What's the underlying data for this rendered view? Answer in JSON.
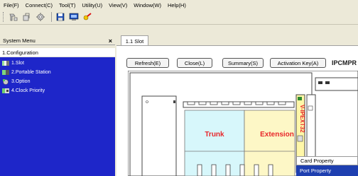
{
  "menubar": {
    "items": [
      "File(F)",
      "Connect(C)",
      "Tool(T)",
      "Utility(U)",
      "View(V)",
      "Window(W)",
      "Help(H)"
    ]
  },
  "toolbar": {
    "icons": [
      "connect-icon",
      "disconnect-icon",
      "settings-icon",
      "save-icon",
      "program-icon",
      "key-icon"
    ]
  },
  "sidebar": {
    "title": "System Menu",
    "close": "×",
    "section": "1.Configuration",
    "items": [
      {
        "label": "1.Slot",
        "icon": "slot-icon"
      },
      {
        "label": "2.Portable Station",
        "icon": "portable-station-icon"
      },
      {
        "label": "3.Option",
        "icon": "option-icon"
      },
      {
        "label": "4.Clock Priority",
        "icon": "clock-priority-icon"
      }
    ]
  },
  "tab": {
    "label": "1.1 Slot"
  },
  "buttons": {
    "refresh": "Refresh(E)",
    "close": "Close(L)",
    "summary": "Summary(S)",
    "activation": "Activation Key(A)"
  },
  "header_label": "IPCMPR",
  "chassis": {
    "trunk_label": "Trunk",
    "extension_label": "Extension",
    "card_label": "V-IPEXT32"
  },
  "context_menu": {
    "card_property": "Card Property",
    "port_property": "Port Property"
  },
  "colors": {
    "nav_bg": "#1e26c9",
    "selected_menu": "#1e3fb0",
    "trunk_text": "#e8262a",
    "extension_fill": "#fdf7c6",
    "card_fill": "#fff7a8"
  }
}
